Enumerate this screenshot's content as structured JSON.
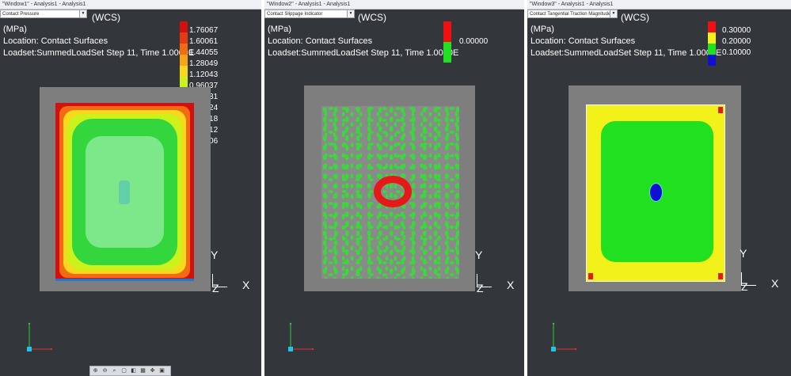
{
  "units": "(MPa)",
  "location": "Location: Contact Surfaces",
  "loadset": "Loadset:SummedLoadSet Step 11, Time  1.0000E",
  "wcs": "(WCS)",
  "axes": {
    "x": "X",
    "y": "Y",
    "z": "Z"
  },
  "windows": [
    {
      "title": "\"Window1\" - Analysis1 - Analysis1",
      "result_type": "Contact Pressure",
      "legend": [
        {
          "color": "#d21010",
          "label": "1.76067"
        },
        {
          "color": "#e63a12",
          "label": "1.60061"
        },
        {
          "color": "#f26a12",
          "label": "1.44055"
        },
        {
          "color": "#f7a21a",
          "label": "1.28049"
        },
        {
          "color": "#f7d81c",
          "label": "1.12043"
        },
        {
          "color": "#ccf21c",
          "label": "0.96037"
        },
        {
          "color": "#7ae62a",
          "label": "0.80031"
        },
        {
          "color": "#34d63e",
          "label": "0.64024"
        },
        {
          "color": "#5cd89a",
          "label": "0.48018"
        },
        {
          "color": "#3ab6cc",
          "label": "0.32012"
        },
        {
          "color": "#1f78d6",
          "label": "0.16006"
        },
        {
          "color": "#1030b0",
          "label": ""
        }
      ]
    },
    {
      "title": "\"Window2\" - Analysis1 - Analysis1",
      "result_type": "Contact Slippage Indicator",
      "legend": [
        {
          "color": "#f01010",
          "label": ""
        },
        {
          "color": "#20e020",
          "label": "0.00000"
        }
      ]
    },
    {
      "title": "\"Window3\" - Analysis1 - Analysis1",
      "result_type": "Contact Tangential Traction Magnitude",
      "legend": [
        {
          "color": "#f01010",
          "label": "0.30000"
        },
        {
          "color": "#f2f21a",
          "label": "0.20000"
        },
        {
          "color": "#20e020",
          "label": "0.10000"
        },
        {
          "color": "#1010d0",
          "label": ""
        }
      ]
    }
  ],
  "toolbar_icons": [
    "zoom-in-icon",
    "zoom-out-icon",
    "zoom-window-icon",
    "refit-icon",
    "view-icon",
    "display-style-icon",
    "orient-icon",
    "named-view-icon"
  ]
}
